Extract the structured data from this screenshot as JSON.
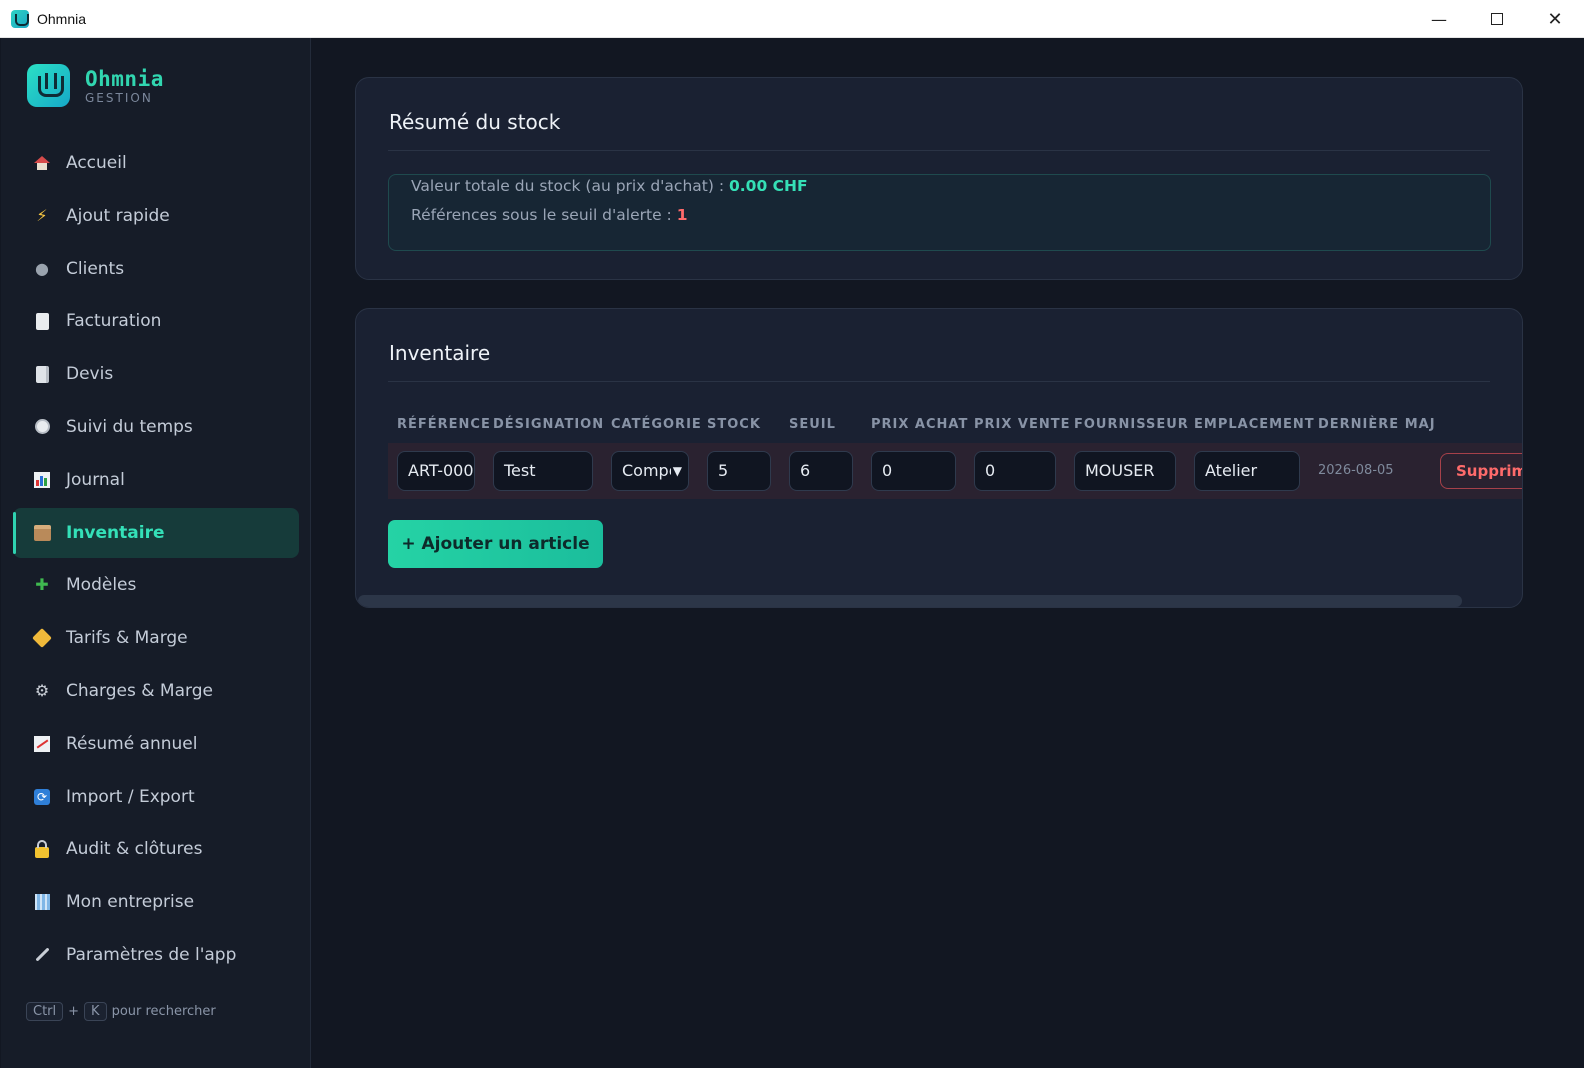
{
  "window": {
    "title": "Ohmnia",
    "controls": {
      "minimize": "—",
      "close": "✕"
    }
  },
  "brand": {
    "name": "Ohmnia",
    "subtitle": "GESTION"
  },
  "sidebar": {
    "items": [
      {
        "label": "Accueil",
        "icon": "home-icon"
      },
      {
        "label": "Ajout rapide",
        "icon": "lightning-icon"
      },
      {
        "label": "Clients",
        "icon": "user-icon"
      },
      {
        "label": "Facturation",
        "icon": "receipt-icon"
      },
      {
        "label": "Devis",
        "icon": "document-icon"
      },
      {
        "label": "Suivi du temps",
        "icon": "stopwatch-icon"
      },
      {
        "label": "Journal",
        "icon": "bar-chart-icon"
      },
      {
        "label": "Inventaire",
        "icon": "box-icon",
        "active": true
      },
      {
        "label": "Modèles",
        "icon": "puzzle-icon"
      },
      {
        "label": "Tarifs & Marge",
        "icon": "tag-icon"
      },
      {
        "label": "Charges & Marge",
        "icon": "gear-icon"
      },
      {
        "label": "Résumé annuel",
        "icon": "trend-chart-icon"
      },
      {
        "label": "Import / Export",
        "icon": "refresh-icon"
      },
      {
        "label": "Audit & clôtures",
        "icon": "lock-icon"
      },
      {
        "label": "Mon entreprise",
        "icon": "building-icon"
      },
      {
        "label": "Paramètres de l'app",
        "icon": "wrench-icon"
      }
    ],
    "shortcut": {
      "key1": "Ctrl",
      "plus": "+",
      "key2": "K",
      "text": "pour rechercher"
    }
  },
  "summary": {
    "title": "Résumé du stock",
    "total_label": "Valeur totale du stock (au prix d'achat) : ",
    "total_value": "0.00 CHF",
    "alert_label": "Références sous le seuil d'alerte : ",
    "alert_value": "1"
  },
  "inventory": {
    "title": "Inventaire",
    "columns": [
      "RÉFÉRENCE",
      "DÉSIGNATION",
      "CATÉGORIE",
      "STOCK",
      "SEUIL",
      "PRIX ACHAT",
      "PRIX VENTE",
      "FOURNISSEUR",
      "EMPLACEMENT",
      "DERNIÈRE MAJ"
    ],
    "rows": [
      {
        "reference": "ART-000",
        "designation": "Test",
        "categorie": "Compo",
        "stock": "5",
        "seuil": "6",
        "prix_achat": "0",
        "prix_vente": "0",
        "fournisseur": "MOUSER",
        "emplacement": "Atelier",
        "derniere_maj": "2026-08-05",
        "delete_label": "Supprimer"
      }
    ],
    "add_label": "+ Ajouter un article"
  },
  "colors": {
    "accent": "#31d6b0",
    "alert": "#ff6b6b",
    "background": "#121722",
    "card": "#1a2132"
  }
}
